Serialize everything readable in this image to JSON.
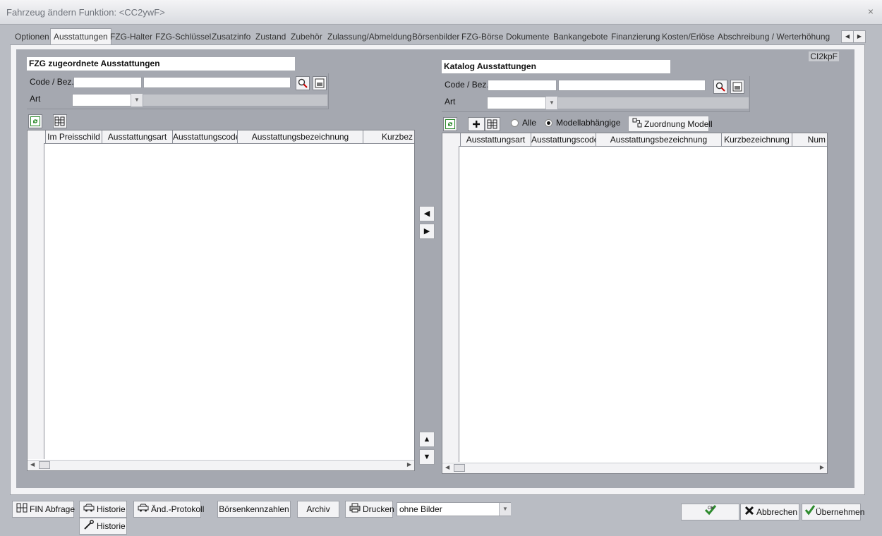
{
  "window": {
    "title": "Fahrzeug ändern   Funktion: <CC2ywF>",
    "close": "×"
  },
  "tabs": [
    {
      "label": "Optionen"
    },
    {
      "label": "Ausstattungen"
    },
    {
      "label": "FZG-Halter"
    },
    {
      "label": "FZG-Schlüssel"
    },
    {
      "label": "Zusatzinfo"
    },
    {
      "label": "Zustand"
    },
    {
      "label": "Zubehör"
    },
    {
      "label": "Zulassung/Abmeldung"
    },
    {
      "label": "Börsenbilder"
    },
    {
      "label": "FZG-Börse"
    },
    {
      "label": "Dokumente"
    },
    {
      "label": "Bankangebote"
    },
    {
      "label": "Finanzierung"
    },
    {
      "label": "Kosten/Erlöse"
    },
    {
      "label": "Abschreibung / Werterhöhung"
    }
  ],
  "active_tab": "Ausstattungen",
  "panel_code": "CI2kpF",
  "left": {
    "title": "FZG zugeordnete Ausstattungen",
    "code_label": "Code / Bez.",
    "art_label": "Art",
    "columns": [
      "Im Preisschild",
      "Ausstattungsart",
      "Ausstattungscode",
      "Ausstattungsbezeichnung",
      "Kurzbez"
    ]
  },
  "right": {
    "title": "Katalog Ausstattungen",
    "code_label": "Code / Bez.",
    "art_label": "Art",
    "radio_all": "Alle",
    "radio_model": "Modellabhängige",
    "assign_model": "Zuordnung Modell",
    "columns": [
      "Ausstattungsart",
      "Ausstattungscode",
      "Ausstattungsbezeichnung",
      "Kurzbezeichnung",
      "Num"
    ]
  },
  "footer": {
    "fin": "FIN Abfrage",
    "historie": "Historie",
    "historie2": "Historie",
    "protokoll": "Änd.-Protokoll",
    "boersenkennzahlen": "Börsenkennzahlen",
    "archiv": "Archiv",
    "drucken": "Drucken",
    "print_option": "ohne Bilder",
    "ok": "OK",
    "abbrechen": "Abbrechen",
    "uebernehmen": "Übernehmen"
  },
  "colors": {
    "accent_green": "#2e8b2e",
    "cancel_red": "#c00000"
  }
}
